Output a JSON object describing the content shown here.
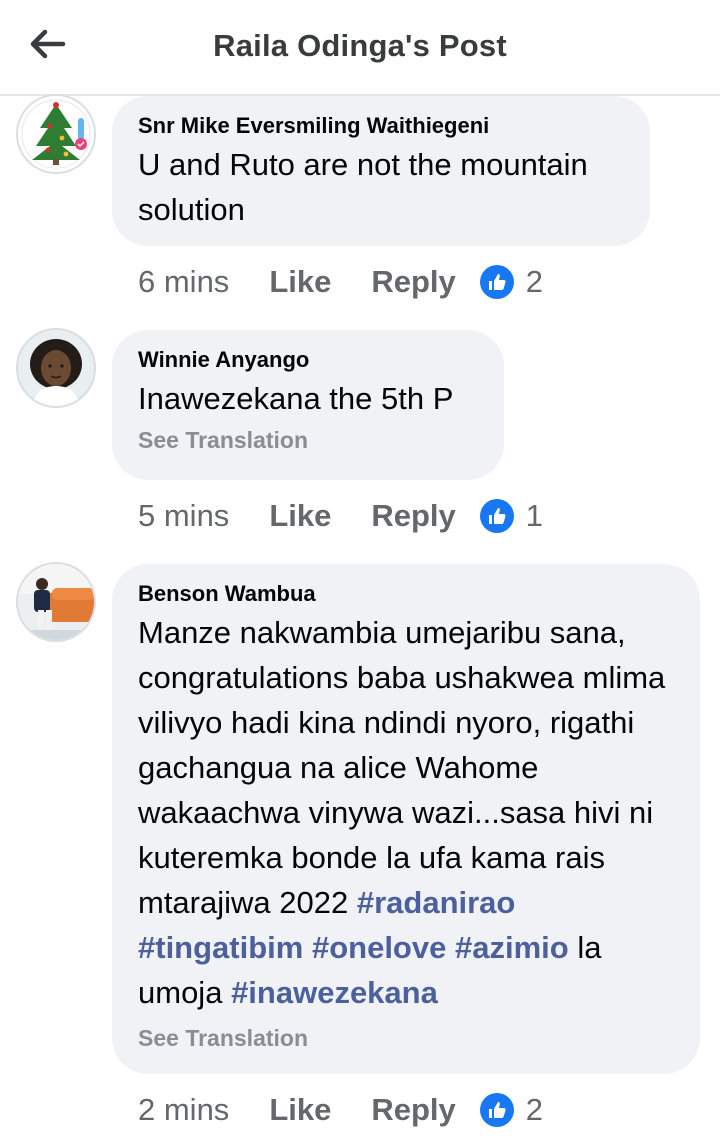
{
  "header": {
    "title": "Raila Odinga's Post",
    "back_icon": "arrow-left-icon"
  },
  "colors": {
    "hashtag": "#4b609d",
    "like_blue": "#1877f2",
    "bubble": "#f0f2f5",
    "meta_gray": "#65676b"
  },
  "comments": [
    {
      "author": "Snr Mike Eversmiling Waithiegeni",
      "text": "U and Ruto are not the mountain solution",
      "time": "6 mins",
      "like_label": "Like",
      "reply_label": "Reply",
      "reactions": "2",
      "avatar_icon": "christmas-tree-avatar"
    },
    {
      "author": "Winnie Anyango",
      "text": "Inawezekana the 5th P",
      "see_translation": "See Translation",
      "time": "5 mins",
      "like_label": "Like",
      "reply_label": "Reply",
      "reactions": "1",
      "avatar_icon": "person-portrait-avatar"
    },
    {
      "author": "Benson Wambua",
      "text_plain": "Manze nakwambia umejaribu sana, congratulations baba ushakwea mlima vilivyo hadi kina ndindi nyoro, rigathi gachangua na alice Wahome wakaachwa vinywa wazi...sasa hivi ni kuteremka bonde la ufa kama rais mtarajiwa 2022",
      "hashtags": [
        "#radanirao",
        "#tingatibim",
        "#onelove",
        "#azimio"
      ],
      "text_mid": "la umoja",
      "hashtag_last": "#inawezekana",
      "see_translation": "See Translation",
      "time": "2 mins",
      "like_label": "Like",
      "reply_label": "Reply",
      "reactions": "2",
      "avatar_icon": "man-on-sofa-avatar"
    }
  ]
}
